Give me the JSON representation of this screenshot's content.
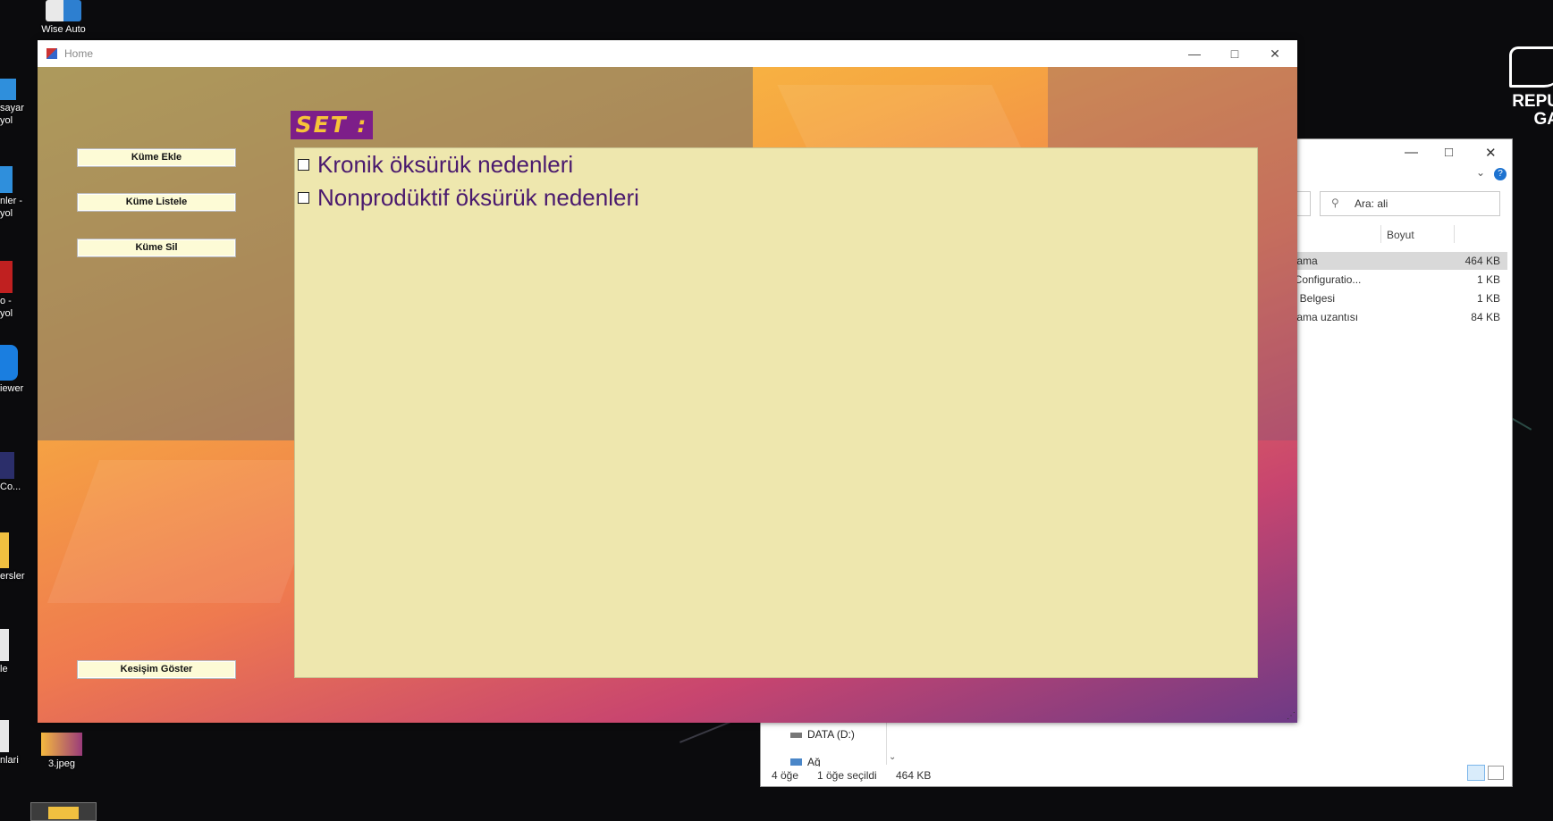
{
  "desktop": {
    "icons": [
      {
        "label": "Wise Auto",
        "sub": ""
      },
      {
        "label": "sayar",
        "sub": "yol"
      },
      {
        "label": "nler -",
        "sub": "yol"
      },
      {
        "label": "o -",
        "sub": "yol"
      },
      {
        "label": "iewer",
        "sub": ""
      },
      {
        "label": "Co...",
        "sub": ""
      },
      {
        "label": "ersler",
        "sub": ""
      },
      {
        "label": "le",
        "sub": ""
      },
      {
        "label": "nlari",
        "sub": ""
      },
      {
        "label": "3.jpeg",
        "sub": ""
      }
    ],
    "logo_text": [
      "REPU",
      "GA"
    ]
  },
  "explorer": {
    "search_placeholder": "Ara: ali",
    "column_size": "Boyut",
    "rows": [
      {
        "name": "ulama",
        "size": "464 KB"
      },
      {
        "name": ". Configuratio...",
        "size": "1 KB"
      },
      {
        "name": "in Belgesi",
        "size": "1 KB"
      },
      {
        "name": "ulama uzantısı",
        "size": "84 KB"
      }
    ],
    "drive": "DATA (D:)",
    "net": "Ağ",
    "status_count": "4 öğe",
    "status_selected": "1 öğe seçildi",
    "status_size": "464 KB"
  },
  "home": {
    "title": "Home",
    "buttons": {
      "add": "Küme Ekle",
      "list": "Küme Listele",
      "delete": "Küme Sil",
      "intersection": "Kesişim Göster"
    },
    "set_label": "SET :",
    "items": [
      {
        "text": "Kronik öksürük nedenleri",
        "checked": false
      },
      {
        "text": "Nonprodüktif öksürük nedenleri",
        "checked": false
      }
    ]
  },
  "colors": {
    "set_bg": "#7d1e89",
    "set_fg": "#f7c338",
    "list_bg": "#eee7ae",
    "item_text": "#4a1a6e"
  }
}
